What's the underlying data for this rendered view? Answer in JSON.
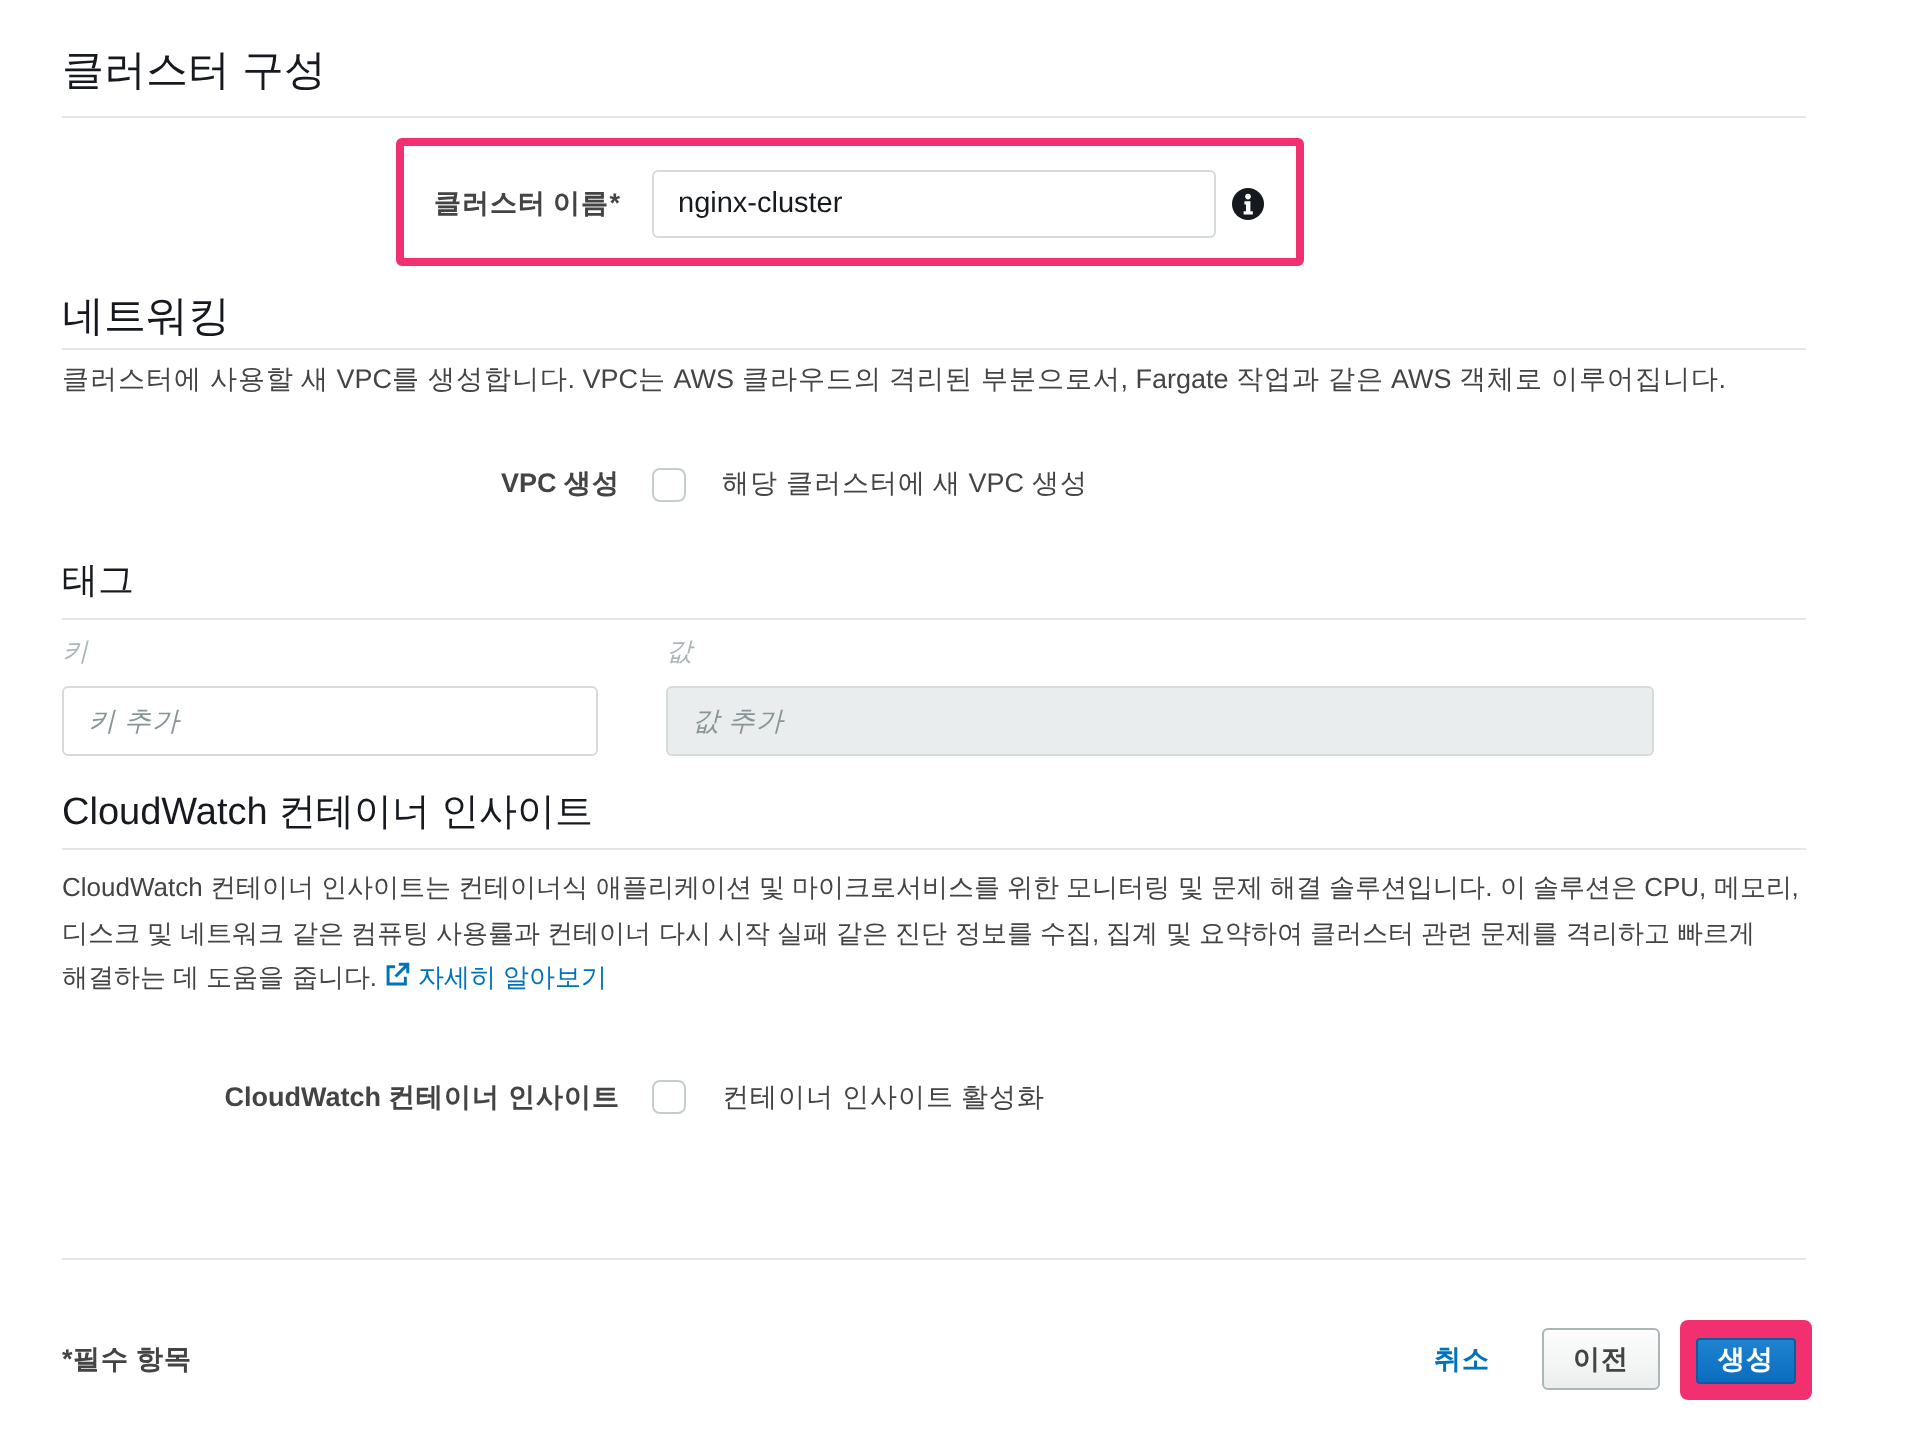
{
  "cluster_config": {
    "title": "클러스터 구성",
    "name_field": {
      "label": "클러스터 이름*",
      "value": "nginx-cluster",
      "highlighted": true
    }
  },
  "networking": {
    "title": "네트워킹",
    "description": "클러스터에 사용할 새 VPC를 생성합니다. VPC는 AWS 클라우드의 격리된 부분으로서, Fargate 작업과 같은 AWS 객체로 이루어집니다.",
    "option": {
      "label": "VPC 생성",
      "text": "해당 클러스터에 새 VPC 생성",
      "checked": false
    }
  },
  "tags": {
    "title": "태그",
    "columns": [
      {
        "label": "키",
        "placeholder": "키 추가",
        "disabled": false
      },
      {
        "label": "값",
        "placeholder": "값 추가",
        "disabled": true
      }
    ]
  },
  "container_insights": {
    "title": "CloudWatch 컨테이너 인사이트",
    "description": "CloudWatch 컨테이너 인사이트는 컨테이너식 애플리케이션 및 마이크로서비스를 위한 모니터링 및 문제 해결 솔루션입니다. 이 솔루션은 CPU, 메모리, 디스크 및 네트워크 같은 컴퓨팅 사용률과 컨테이너 다시 시작 실패 같은 진단 정보를 수집, 집계 및 요약하여 클러스터 관련 문제를 격리하고 빠르게 해결하는 데 도움을 줍니다.",
    "link": "자세히 알아보기",
    "option": {
      "label": "CloudWatch 컨테이너 인사이트",
      "text": "컨테이너 인사이트 활성화",
      "checked": false
    }
  },
  "footer": {
    "required_note": "*필수 항목",
    "buttons": [
      {
        "kind": "link",
        "label": "취소",
        "highlighted": false
      },
      {
        "kind": "secondary",
        "label": "이전",
        "highlighted": false
      },
      {
        "kind": "primary",
        "label": "생성",
        "highlighted": true
      }
    ]
  }
}
